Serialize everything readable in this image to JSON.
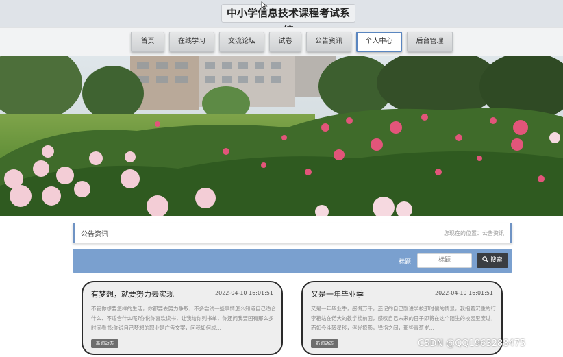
{
  "header": {
    "title": "中小学信息技术课程考试系统"
  },
  "nav": {
    "items": [
      {
        "label": "首页",
        "active": false
      },
      {
        "label": "在线学习",
        "active": false
      },
      {
        "label": "交流论坛",
        "active": false
      },
      {
        "label": "试卷",
        "active": false
      },
      {
        "label": "公告资讯",
        "active": false
      },
      {
        "label": "个人中心",
        "active": true
      },
      {
        "label": "后台管理",
        "active": false
      }
    ]
  },
  "banner": {
    "slide_count": 3,
    "active_slide": 1
  },
  "section": {
    "title": "公告资讯",
    "breadcrumb": "您现在的位置：公告资讯"
  },
  "search": {
    "label": "标题",
    "placeholder": "标题",
    "button_label": "搜索"
  },
  "cards": [
    {
      "title": "有梦想，就要努力去实现",
      "date": "2022-04-10 16:01:51",
      "body": "不管你想要怎样的生活，你都要去努力争取，不多尝试一些事情怎么知道自己适合什么、不适合什么呢?你说你喜欢读书，让我给你列书单，你还问我要国有那么多时间看书;你说自己梦想的职业是广告文案，问我如何成…",
      "tag": "新闻动态"
    },
    {
      "title": "又是一年毕业季",
      "date": "2022-04-10 16:01:51",
      "body": "又是一年毕业季，感慨万千，还记的自己刚进学校那时候的情景，我抱着沉重的行李箱站在偌大的教学楼前面，感叹自己未来的日子即将在这个陌生的校园里度过，而如今斗转星移，浮光掠影，弹指之间，那些青葱岁…",
      "tag": "新闻动态"
    }
  ],
  "watermark": "CSDN @QQ1963288475",
  "colors": {
    "accent": "#6f93c4",
    "search_bar": "#7aa0cf",
    "header_bg": "#dfe3e8",
    "card_bg": "#eeeeee"
  }
}
